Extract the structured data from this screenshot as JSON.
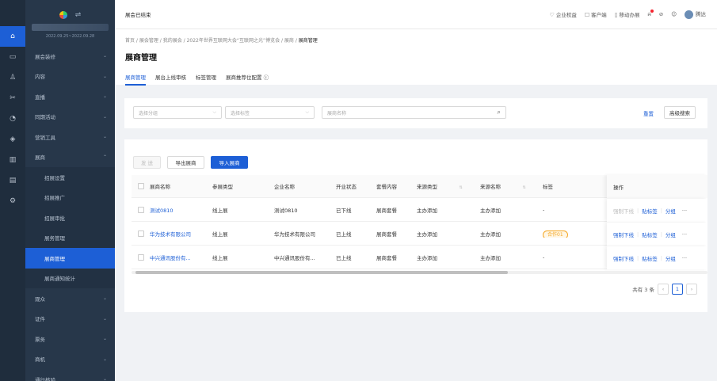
{
  "rail": {
    "items": [
      {
        "icon": "home-icon",
        "glyph": "⌂",
        "active": true
      },
      {
        "icon": "message-icon",
        "glyph": "▭",
        "active": false
      },
      {
        "icon": "user-icon",
        "glyph": "♙",
        "active": false
      },
      {
        "icon": "share-icon",
        "glyph": "✂",
        "active": false
      },
      {
        "icon": "search-icon",
        "glyph": "◔",
        "active": false
      },
      {
        "icon": "location-icon",
        "glyph": "◈",
        "active": false
      },
      {
        "icon": "chart-icon",
        "glyph": "▥",
        "active": false
      },
      {
        "icon": "folder-icon",
        "glyph": "▤",
        "active": false
      },
      {
        "icon": "settings-icon",
        "glyph": "⚙",
        "active": false
      }
    ]
  },
  "sidebar": {
    "logo_switch": "⇌",
    "event_date": "2022.09.25~2022.09.28",
    "menu_top": [
      "展会装修",
      "内容",
      "直播",
      "同期活动",
      "营销工具"
    ],
    "menu_exhibitor": "展商",
    "sub_items": [
      "招展设置",
      "招展推广",
      "招展审批",
      "展务管理",
      "展商管理",
      "展商通知统计"
    ],
    "active_sub": 4,
    "menu_bottom": [
      "观众",
      "证件",
      "票务",
      "商机",
      "通行核验"
    ]
  },
  "topbar": {
    "status": "展会已结束",
    "links": [
      {
        "icon": "shield-icon",
        "glyph": "♡",
        "label": "企业权益"
      },
      {
        "icon": "client-icon",
        "glyph": "☐",
        "label": "客户端"
      },
      {
        "icon": "mobile-icon",
        "glyph": "▯",
        "label": "移动办展"
      }
    ],
    "user": "腾达"
  },
  "header": {
    "breadcrumb": [
      "首页",
      "展会管理",
      "我的展会",
      "2022年世界互联网大会“互联网之光”博览会",
      "展商"
    ],
    "breadcrumb_current": "展商管理",
    "title": "展商管理",
    "tabs": [
      "展商管理",
      "展台上线审核",
      "标签管理",
      "展商推荐位配置"
    ],
    "active_tab": 0
  },
  "filter": {
    "group_placeholder": "选择分组",
    "tag_placeholder": "选择标签",
    "name_placeholder": "展商名称",
    "reset": "重置",
    "advanced": "高级搜索"
  },
  "table": {
    "toolbar": {
      "send": "发 送",
      "export": "导出展商",
      "import": "导入展商"
    },
    "columns": [
      "展商名称",
      "参展类型",
      "企业名称",
      "开业状态",
      "套餐内容",
      "来源类型",
      "来源名称",
      "标签",
      "操作"
    ],
    "rows": [
      {
        "name": "测试0810",
        "type": "线上展",
        "company": "测试0810",
        "status": "已下线",
        "package": "展商套餐",
        "source_type": "主办添加",
        "source_name": "主办添加",
        "tag": "-",
        "op_online": "强制下线",
        "op_online_disabled": true
      },
      {
        "name": "华为技术有限公司",
        "type": "线上展",
        "company": "华为技术有限公司",
        "status": "已上线",
        "package": "展商套餐",
        "source_type": "主办添加",
        "source_name": "主办添加",
        "tag": "合作01",
        "op_online": "强制下线",
        "op_online_disabled": false
      },
      {
        "name": "中兴通讯股份有...",
        "type": "线上展",
        "company": "中兴通讯股份有...",
        "status": "已上线",
        "package": "展商套餐",
        "source_type": "主办添加",
        "source_name": "主办添加",
        "tag": "-",
        "op_online": "强制下线",
        "op_online_disabled": false
      }
    ],
    "op_tag": "贴标签",
    "op_group": "分组",
    "op_more": "···",
    "total_text": "共有 3 条",
    "current_page": "1"
  }
}
